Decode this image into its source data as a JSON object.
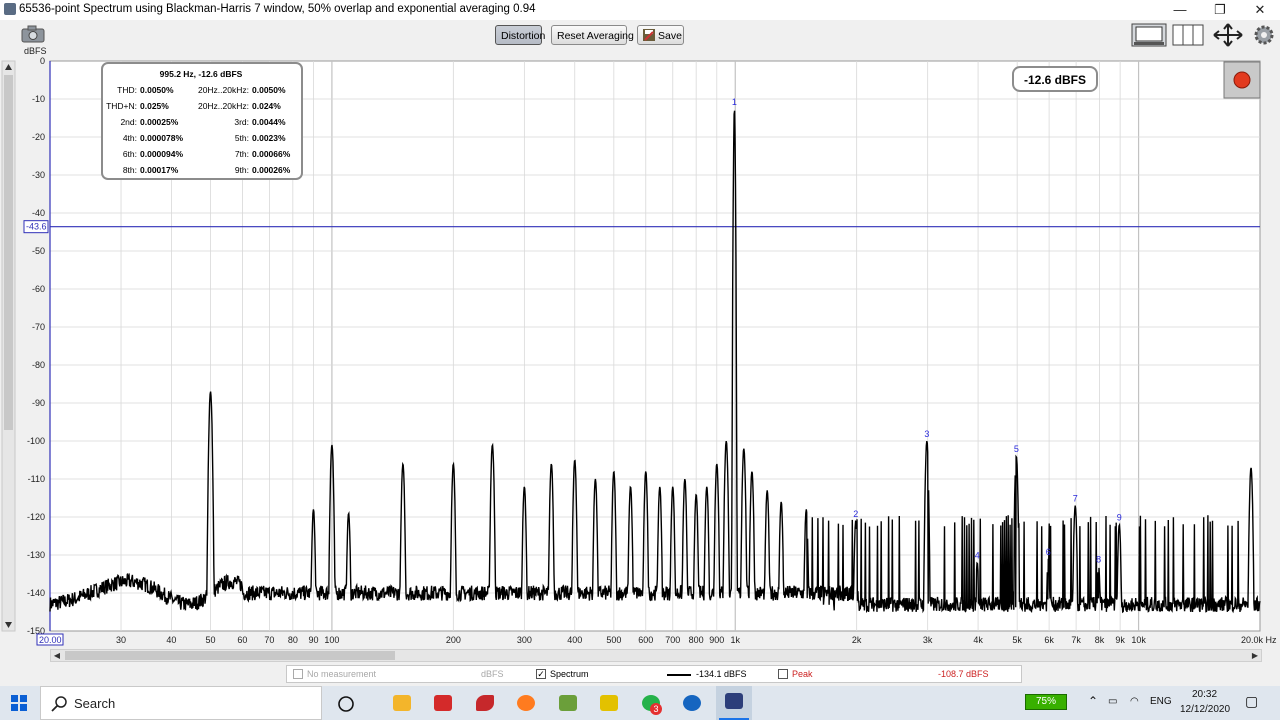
{
  "window": {
    "title": "65536-point Spectrum using Blackman-Harris 7 window, 50% overlap and exponential averaging 0.94",
    "minimize": "—",
    "restore": "❐",
    "close": "✕"
  },
  "toolbar": {
    "distortion_label": "Distortion",
    "reset_label": "Reset Averaging",
    "save_label": "Save",
    "unit_label": "dBFS"
  },
  "plot": {
    "peak_readout": "-12.6 dBFS",
    "cursor_level_label": "-43.6",
    "freq_left_label": "20.00",
    "freq_right_label": "20.0k Hz",
    "distortion": {
      "header": "995.2 Hz, -12.6 dBFS",
      "rows": [
        {
          "l_label": "THD:",
          "l_val": "0.0050%",
          "r_label": "20Hz..20kHz:",
          "r_val": "0.0050%"
        },
        {
          "l_label": "THD+N:",
          "l_val": "0.025%",
          "r_label": "20Hz..20kHz:",
          "r_val": "0.024%"
        },
        {
          "l_label": "2nd:",
          "l_val": "0.00025%",
          "r_label": "3rd:",
          "r_val": "0.0044%"
        },
        {
          "l_label": "4th:",
          "l_val": "0.000078%",
          "r_label": "5th:",
          "r_val": "0.0023%"
        },
        {
          "l_label": "6th:",
          "l_val": "0.000094%",
          "r_label": "7th:",
          "r_val": "0.00066%"
        },
        {
          "l_label": "8th:",
          "l_val": "0.00017%",
          "r_label": "9th:",
          "r_val": "0.00026%"
        }
      ]
    }
  },
  "chart_data": {
    "type": "line",
    "ylabel": "dBFS",
    "xlabel": "Hz",
    "x_scale": "log",
    "xlim": [
      20,
      20000
    ],
    "ylim": [
      -150,
      0
    ],
    "y_ticks": [
      0,
      -10,
      -20,
      -30,
      -40,
      -50,
      -60,
      -70,
      -80,
      -90,
      -100,
      -110,
      -120,
      -130,
      -140,
      -150
    ],
    "x_tick_labels": [
      {
        "f": 30,
        "label": "30"
      },
      {
        "f": 40,
        "label": "40"
      },
      {
        "f": 50,
        "label": "50"
      },
      {
        "f": 60,
        "label": "60"
      },
      {
        "f": 70,
        "label": "70"
      },
      {
        "f": 80,
        "label": "80"
      },
      {
        "f": 90,
        "label": "90"
      },
      {
        "f": 100,
        "label": "100"
      },
      {
        "f": 200,
        "label": "200"
      },
      {
        "f": 300,
        "label": "300"
      },
      {
        "f": 400,
        "label": "400"
      },
      {
        "f": 500,
        "label": "500"
      },
      {
        "f": 600,
        "label": "600"
      },
      {
        "f": 700,
        "label": "700"
      },
      {
        "f": 800,
        "label": "800"
      },
      {
        "f": 900,
        "label": "900"
      },
      {
        "f": 1000,
        "label": "1k"
      },
      {
        "f": 2000,
        "label": "2k"
      },
      {
        "f": 3000,
        "label": "3k"
      },
      {
        "f": 4000,
        "label": "4k"
      },
      {
        "f": 5000,
        "label": "5k"
      },
      {
        "f": 6000,
        "label": "6k"
      },
      {
        "f": 7000,
        "label": "7k"
      },
      {
        "f": 8000,
        "label": "8k"
      },
      {
        "f": 9000,
        "label": "9k"
      },
      {
        "f": 10000,
        "label": "10k"
      }
    ],
    "cursor_level": -43.6,
    "series": [
      {
        "name": "Spectrum",
        "peaks": [
          {
            "f": 50,
            "db": -87
          },
          {
            "f": 90,
            "db": -118
          },
          {
            "f": 100,
            "db": -101
          },
          {
            "f": 110,
            "db": -119
          },
          {
            "f": 150,
            "db": -106
          },
          {
            "f": 200,
            "db": -106
          },
          {
            "f": 250,
            "db": -101
          },
          {
            "f": 300,
            "db": -112
          },
          {
            "f": 350,
            "db": -106
          },
          {
            "f": 400,
            "db": -105
          },
          {
            "f": 450,
            "db": -110
          },
          {
            "f": 500,
            "db": -108
          },
          {
            "f": 550,
            "db": -112
          },
          {
            "f": 600,
            "db": -108
          },
          {
            "f": 650,
            "db": -112
          },
          {
            "f": 700,
            "db": -112
          },
          {
            "f": 750,
            "db": -110
          },
          {
            "f": 800,
            "db": -114
          },
          {
            "f": 850,
            "db": -112
          },
          {
            "f": 900,
            "db": -106
          },
          {
            "f": 950,
            "db": -100
          },
          {
            "f": 995.2,
            "db": -12.6
          },
          {
            "f": 1050,
            "db": -102
          },
          {
            "f": 1100,
            "db": -108
          },
          {
            "f": 1200,
            "db": -113
          },
          {
            "f": 1300,
            "db": -116
          },
          {
            "f": 1500,
            "db": -118
          },
          {
            "f": 1990,
            "db": -121
          },
          {
            "f": 2986,
            "db": -100
          },
          {
            "f": 3981,
            "db": -132
          },
          {
            "f": 4976,
            "db": -104
          },
          {
            "f": 5971,
            "db": -131
          },
          {
            "f": 6966,
            "db": -117
          },
          {
            "f": 7962,
            "db": -133
          },
          {
            "f": 8957,
            "db": -122
          },
          {
            "f": 19000,
            "db": -107
          }
        ],
        "noise_floor_db": -140
      }
    ],
    "harmonic_markers": [
      {
        "label": "1",
        "f": 995.2,
        "db": -12.6
      },
      {
        "label": "2",
        "f": 1990,
        "db": -121
      },
      {
        "label": "3",
        "f": 2986,
        "db": -100
      },
      {
        "label": "4",
        "f": 3981,
        "db": -132
      },
      {
        "label": "5",
        "f": 4976,
        "db": -104
      },
      {
        "label": "6",
        "f": 5971,
        "db": -131
      },
      {
        "label": "7",
        "f": 6966,
        "db": -117
      },
      {
        "label": "8",
        "f": 7962,
        "db": -133
      },
      {
        "label": "9",
        "f": 8957,
        "db": -122
      }
    ],
    "colors": {
      "trace": "#000000",
      "cursor": "#3030b8",
      "marker": "#2b2bdc",
      "grid": "#d8d8d8",
      "background": "#ffffff"
    }
  },
  "legend": {
    "no_measurement": "No measurement",
    "unit1": "dBFS",
    "spectrum": "Spectrum",
    "spectrum_value": "-134.1 dBFS",
    "peak": "Peak",
    "peak_value": "-108.7 dBFS",
    "spectrum_checked": "✓"
  },
  "taskbar": {
    "search_label": "Search",
    "battery": "75%",
    "language": "ENG",
    "time": "20:32",
    "date": "12/12/2020",
    "whatsapp_badge": "3"
  }
}
